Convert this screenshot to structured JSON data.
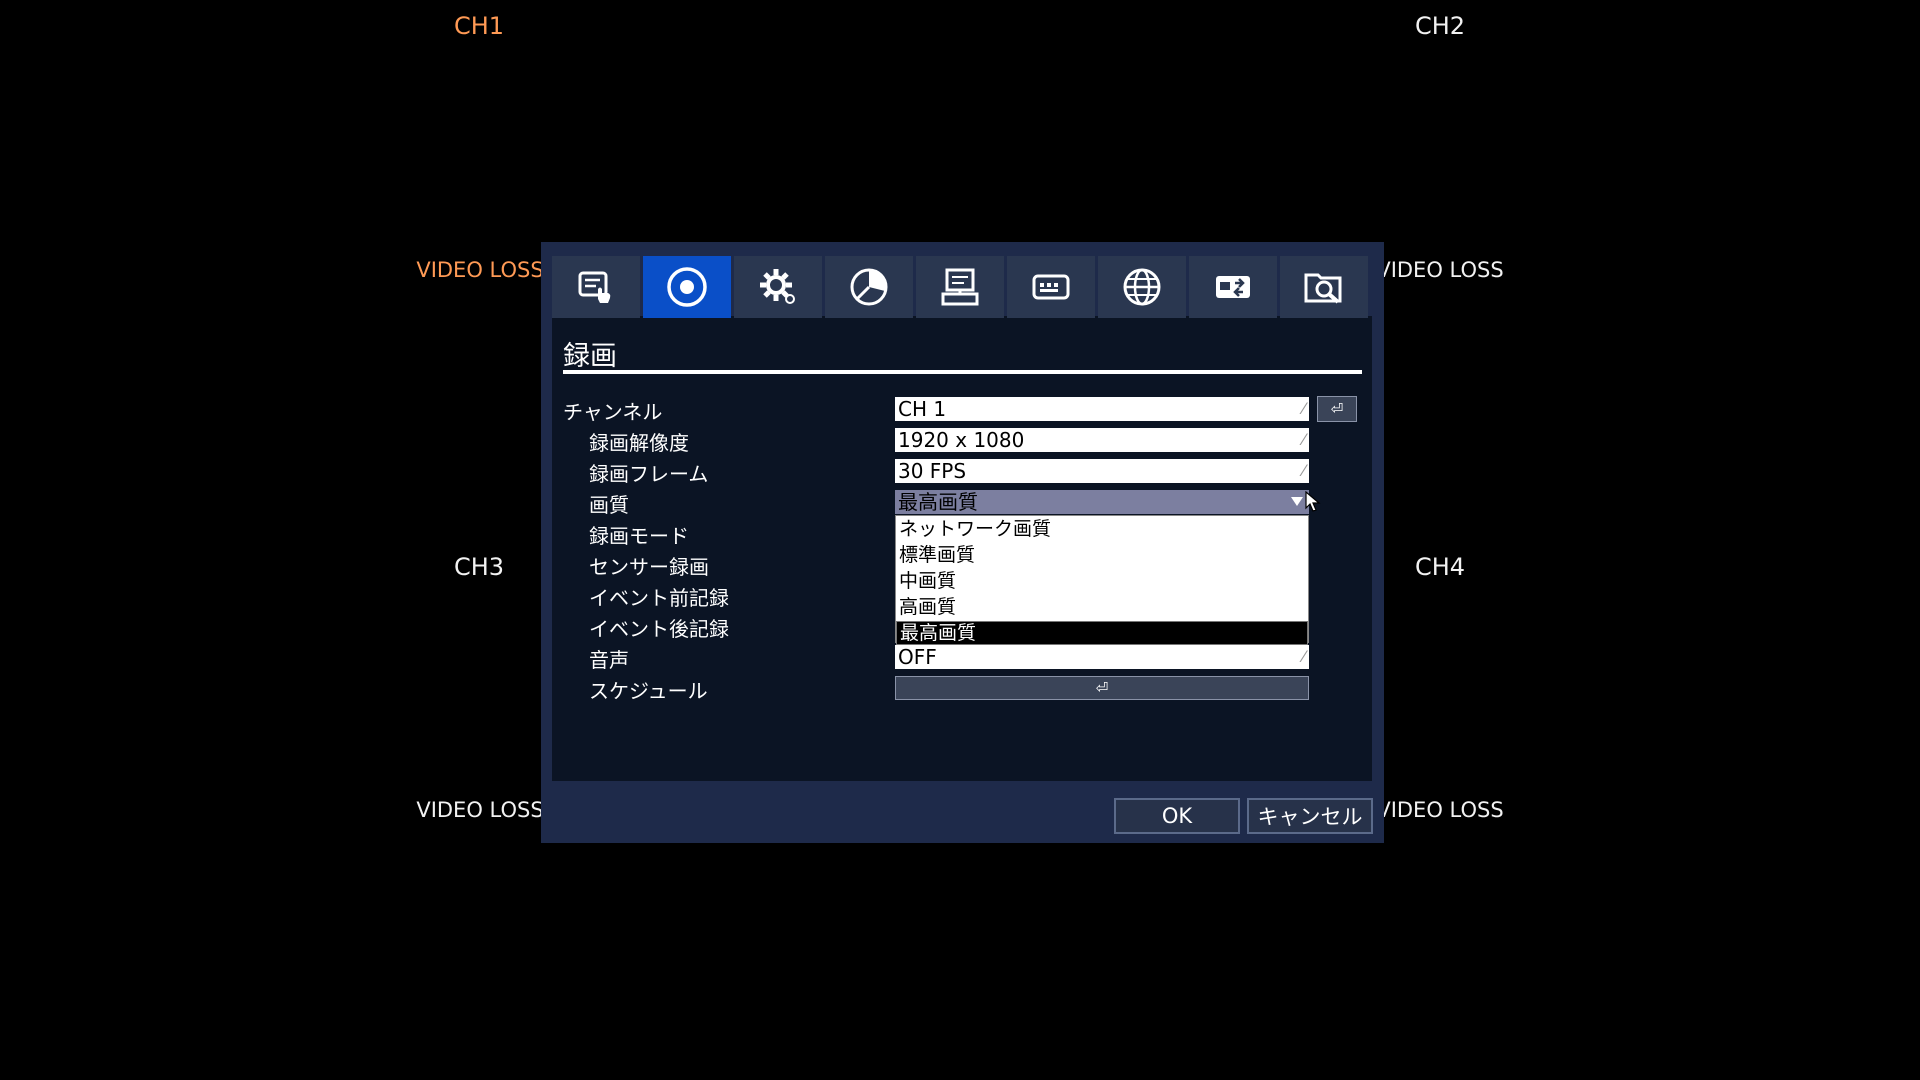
{
  "channels": {
    "ch1": {
      "label": "CH1",
      "status": "VIDEO LOSS"
    },
    "ch2": {
      "label": "CH2",
      "status": "VIDEO LOSS"
    },
    "ch3": {
      "label": "CH3",
      "status": "VIDEO LOSS"
    },
    "ch4": {
      "label": "CH4",
      "status": "VIDEO LOSS"
    }
  },
  "tabs": [
    {
      "icon": "setup-hand-icon",
      "active": false
    },
    {
      "icon": "record-icon",
      "active": true
    },
    {
      "icon": "gear-icon",
      "active": false
    },
    {
      "icon": "pie-chart-icon",
      "active": false
    },
    {
      "icon": "computer-icon",
      "active": false
    },
    {
      "icon": "keyboard-icon",
      "active": false
    },
    {
      "icon": "globe-icon",
      "active": false
    },
    {
      "icon": "usb-drive-icon",
      "active": false
    },
    {
      "icon": "search-folder-icon",
      "active": false
    }
  ],
  "title": "録画",
  "rows": {
    "channel": {
      "label": "チャンネル",
      "value": "CH 1"
    },
    "resolution": {
      "label": "録画解像度",
      "value": "1920 x 1080"
    },
    "frame": {
      "label": "録画フレーム",
      "value": "30 FPS"
    },
    "quality": {
      "label": "画質",
      "value": "最高画質"
    },
    "mode": {
      "label": "録画モード"
    },
    "sensor": {
      "label": "センサー録画"
    },
    "pre_event": {
      "label": "イベント前記録"
    },
    "post_event": {
      "label": "イベント後記録"
    },
    "audio": {
      "label": "音声",
      "value": "OFF"
    },
    "schedule": {
      "label": "スケジュール"
    }
  },
  "quality_options": [
    "ネットワーク画質",
    "標準画質",
    "中画質",
    "高画質",
    "最高画質"
  ],
  "quality_selected_index": 4,
  "enter_glyph": "⏎",
  "buttons": {
    "ok": "OK",
    "cancel": "キャンセル"
  },
  "colors": {
    "accent": "#0a4fc8",
    "orange": "#ff9a55",
    "dialog_bg": "#1e2a4a"
  }
}
